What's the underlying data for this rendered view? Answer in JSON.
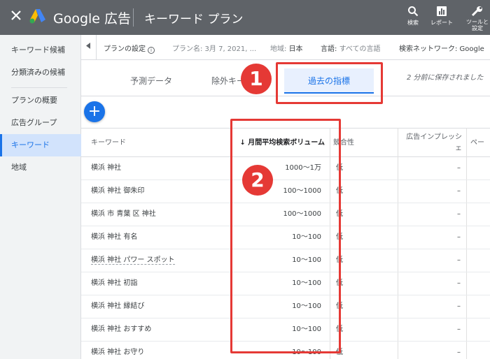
{
  "header": {
    "close_icon": "close-icon",
    "brand": "Google 広告",
    "title": "キーワード プラン",
    "tools": [
      {
        "icon": "search-icon",
        "label": "検索"
      },
      {
        "icon": "bar-chart-icon",
        "label": "レポート"
      },
      {
        "icon": "wrench-icon",
        "label_line1": "ツールと",
        "label_line2": "設定"
      }
    ]
  },
  "sidebar": {
    "items": [
      {
        "label": "キーワード候補"
      },
      {
        "label": "分類済みの候補"
      },
      {
        "label": "プランの概要"
      },
      {
        "label": "広告グループ"
      },
      {
        "label": "キーワード",
        "active": true
      },
      {
        "label": "地域"
      }
    ]
  },
  "settings": {
    "plan_settings": "プランの設定",
    "plan_name": "プラン名: 3月 7, 2021, ...",
    "region_label": "地域:",
    "region_value": "日本",
    "language_label": "言語:",
    "language_value": "すべての言語",
    "network": "検索ネットワーク: Google"
  },
  "tabs": {
    "items": [
      {
        "label": "予測データ"
      },
      {
        "label": "除外キー"
      },
      {
        "label": "過去の指標",
        "active": true
      }
    ],
    "saved_status": "2 分前に保存されました"
  },
  "fab": {
    "label": "+"
  },
  "table": {
    "columns": {
      "keyword": "キーワード",
      "volume": "↓ 月間平均検索ボリューム",
      "competition": "競合性",
      "impression_line1": "広告インプレッシ",
      "impression_line2": "ェ",
      "page": "ペー"
    },
    "rows": [
      {
        "keyword": "横浜 神社",
        "volume": "1000～1万",
        "competition": "低",
        "impression": "–"
      },
      {
        "keyword": "横浜 神社 御朱印",
        "volume": "100～1000",
        "competition": "低",
        "impression": "–"
      },
      {
        "keyword": "横浜 市 青葉 区 神社",
        "volume": "100～1000",
        "competition": "低",
        "impression": "–"
      },
      {
        "keyword": "横浜 神社 有名",
        "volume": "10～100",
        "competition": "低",
        "impression": "–"
      },
      {
        "keyword": "横浜 神社 パワー スポット",
        "volume": "10～100",
        "competition": "低",
        "impression": "–"
      },
      {
        "keyword": "横浜 神社 初詣",
        "volume": "10～100",
        "competition": "低",
        "impression": "–"
      },
      {
        "keyword": "横浜 神社 縁結び",
        "volume": "10～100",
        "competition": "低",
        "impression": "–"
      },
      {
        "keyword": "横浜 神社 おすすめ",
        "volume": "10～100",
        "competition": "低",
        "impression": "–"
      },
      {
        "keyword": "横浜 神社 お守り",
        "volume": "10～100",
        "competition": "低",
        "impression": "–"
      }
    ]
  },
  "annotations": {
    "badge1": "1",
    "badge2": "2",
    "color": "#e53935"
  }
}
